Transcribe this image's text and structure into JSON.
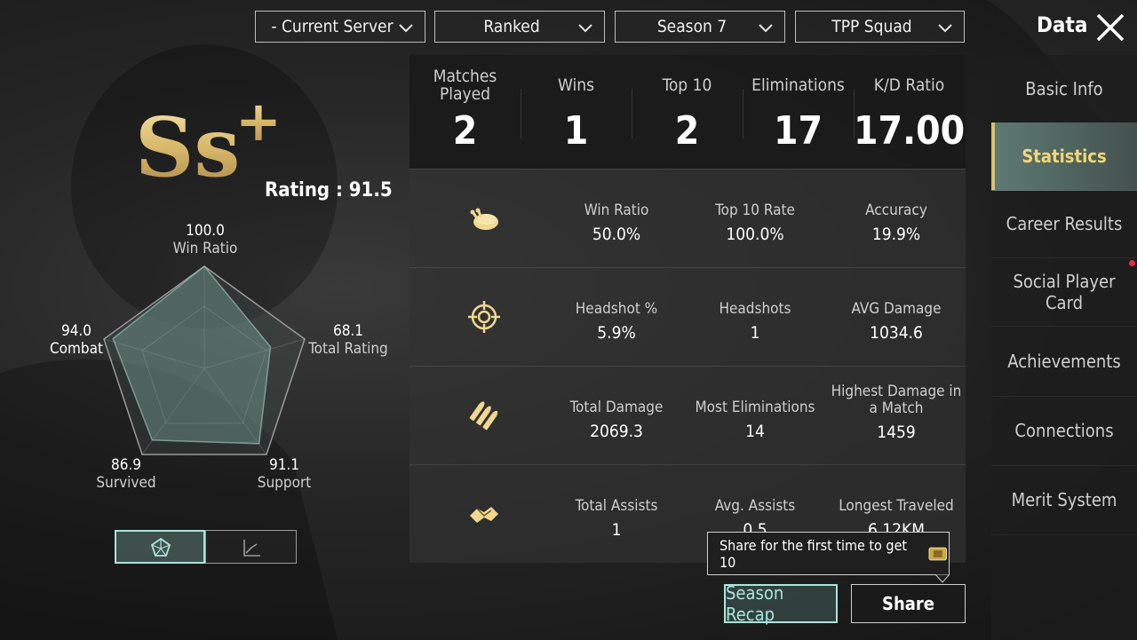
{
  "filters": {
    "server": "- Current Server",
    "mode": "Ranked",
    "season": "Season 7",
    "squad": "TPP Squad"
  },
  "header": {
    "title": "Data"
  },
  "sidebar": {
    "items": [
      {
        "label": "Basic Info"
      },
      {
        "label": "Statistics"
      },
      {
        "label": "Career Results"
      },
      {
        "label": "Social Player Card"
      },
      {
        "label": "Achievements"
      },
      {
        "label": "Connections"
      },
      {
        "label": "Merit System"
      }
    ],
    "active": "Statistics"
  },
  "rank": {
    "badge": "Ss",
    "plus": "+",
    "rating_text": "Rating : 91.5"
  },
  "radar": {
    "axes": [
      {
        "name": "Win Ratio",
        "value": "100.0"
      },
      {
        "name": "Total Rating",
        "value": "68.1"
      },
      {
        "name": "Support",
        "value": "91.1"
      },
      {
        "name": "Survived",
        "value": "86.9"
      },
      {
        "name": "Combat",
        "value": "94.0"
      }
    ]
  },
  "summary": {
    "matches_played": {
      "label": "Matches Played",
      "value": "2"
    },
    "wins": {
      "label": "Wins",
      "value": "1"
    },
    "top10": {
      "label": "Top 10",
      "value": "2"
    },
    "eliminations": {
      "label": "Eliminations",
      "value": "17"
    },
    "kd": {
      "label": "K/D Ratio",
      "value": "17.00"
    }
  },
  "rows": [
    {
      "icon": "chicken-icon",
      "cells": [
        {
          "label": "Win Ratio",
          "value": "50.0%"
        },
        {
          "label": "Top 10 Rate",
          "value": "100.0%"
        },
        {
          "label": "Accuracy",
          "value": "19.9%"
        }
      ]
    },
    {
      "icon": "crosshair-icon",
      "cells": [
        {
          "label": "Headshot %",
          "value": "5.9%"
        },
        {
          "label": "Headshots",
          "value": "1"
        },
        {
          "label": "AVG Damage",
          "value": "1034.6"
        }
      ]
    },
    {
      "icon": "bullets-icon",
      "cells": [
        {
          "label": "Total Damage",
          "value": "2069.3"
        },
        {
          "label": "Most Eliminations",
          "value": "14"
        },
        {
          "label": "Highest Damage in a Match",
          "value": "1459"
        }
      ]
    },
    {
      "icon": "handshake-icon",
      "cells": [
        {
          "label": "Total Assists",
          "value": "1"
        },
        {
          "label": "Avg. Assists",
          "value": "0.5"
        },
        {
          "label": "Longest Traveled",
          "value": "6.12KM"
        }
      ]
    }
  ],
  "tooltip": {
    "text": "Share for the first time to get 10"
  },
  "buttons": {
    "season_recap": "Season Recap",
    "share": "Share"
  },
  "colors": {
    "accent_gold": "#f3d774",
    "accent_teal": "#a8e6dc",
    "panel_dark": "#1a1a1a"
  }
}
